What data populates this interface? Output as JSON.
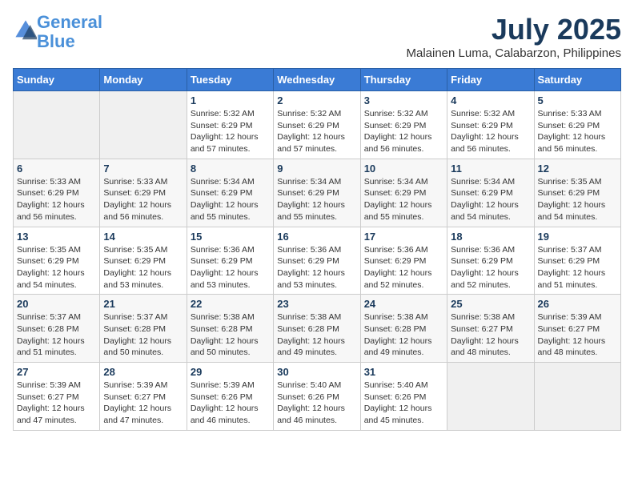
{
  "header": {
    "logo_line1": "General",
    "logo_line2": "Blue",
    "month": "July 2025",
    "location": "Malainen Luma, Calabarzon, Philippines"
  },
  "days_of_week": [
    "Sunday",
    "Monday",
    "Tuesday",
    "Wednesday",
    "Thursday",
    "Friday",
    "Saturday"
  ],
  "weeks": [
    [
      {
        "day": "",
        "info": ""
      },
      {
        "day": "",
        "info": ""
      },
      {
        "day": "1",
        "info": "Sunrise: 5:32 AM\nSunset: 6:29 PM\nDaylight: 12 hours and 57 minutes."
      },
      {
        "day": "2",
        "info": "Sunrise: 5:32 AM\nSunset: 6:29 PM\nDaylight: 12 hours and 57 minutes."
      },
      {
        "day": "3",
        "info": "Sunrise: 5:32 AM\nSunset: 6:29 PM\nDaylight: 12 hours and 56 minutes."
      },
      {
        "day": "4",
        "info": "Sunrise: 5:32 AM\nSunset: 6:29 PM\nDaylight: 12 hours and 56 minutes."
      },
      {
        "day": "5",
        "info": "Sunrise: 5:33 AM\nSunset: 6:29 PM\nDaylight: 12 hours and 56 minutes."
      }
    ],
    [
      {
        "day": "6",
        "info": "Sunrise: 5:33 AM\nSunset: 6:29 PM\nDaylight: 12 hours and 56 minutes."
      },
      {
        "day": "7",
        "info": "Sunrise: 5:33 AM\nSunset: 6:29 PM\nDaylight: 12 hours and 56 minutes."
      },
      {
        "day": "8",
        "info": "Sunrise: 5:34 AM\nSunset: 6:29 PM\nDaylight: 12 hours and 55 minutes."
      },
      {
        "day": "9",
        "info": "Sunrise: 5:34 AM\nSunset: 6:29 PM\nDaylight: 12 hours and 55 minutes."
      },
      {
        "day": "10",
        "info": "Sunrise: 5:34 AM\nSunset: 6:29 PM\nDaylight: 12 hours and 55 minutes."
      },
      {
        "day": "11",
        "info": "Sunrise: 5:34 AM\nSunset: 6:29 PM\nDaylight: 12 hours and 54 minutes."
      },
      {
        "day": "12",
        "info": "Sunrise: 5:35 AM\nSunset: 6:29 PM\nDaylight: 12 hours and 54 minutes."
      }
    ],
    [
      {
        "day": "13",
        "info": "Sunrise: 5:35 AM\nSunset: 6:29 PM\nDaylight: 12 hours and 54 minutes."
      },
      {
        "day": "14",
        "info": "Sunrise: 5:35 AM\nSunset: 6:29 PM\nDaylight: 12 hours and 53 minutes."
      },
      {
        "day": "15",
        "info": "Sunrise: 5:36 AM\nSunset: 6:29 PM\nDaylight: 12 hours and 53 minutes."
      },
      {
        "day": "16",
        "info": "Sunrise: 5:36 AM\nSunset: 6:29 PM\nDaylight: 12 hours and 53 minutes."
      },
      {
        "day": "17",
        "info": "Sunrise: 5:36 AM\nSunset: 6:29 PM\nDaylight: 12 hours and 52 minutes."
      },
      {
        "day": "18",
        "info": "Sunrise: 5:36 AM\nSunset: 6:29 PM\nDaylight: 12 hours and 52 minutes."
      },
      {
        "day": "19",
        "info": "Sunrise: 5:37 AM\nSunset: 6:29 PM\nDaylight: 12 hours and 51 minutes."
      }
    ],
    [
      {
        "day": "20",
        "info": "Sunrise: 5:37 AM\nSunset: 6:28 PM\nDaylight: 12 hours and 51 minutes."
      },
      {
        "day": "21",
        "info": "Sunrise: 5:37 AM\nSunset: 6:28 PM\nDaylight: 12 hours and 50 minutes."
      },
      {
        "day": "22",
        "info": "Sunrise: 5:38 AM\nSunset: 6:28 PM\nDaylight: 12 hours and 50 minutes."
      },
      {
        "day": "23",
        "info": "Sunrise: 5:38 AM\nSunset: 6:28 PM\nDaylight: 12 hours and 49 minutes."
      },
      {
        "day": "24",
        "info": "Sunrise: 5:38 AM\nSunset: 6:28 PM\nDaylight: 12 hours and 49 minutes."
      },
      {
        "day": "25",
        "info": "Sunrise: 5:38 AM\nSunset: 6:27 PM\nDaylight: 12 hours and 48 minutes."
      },
      {
        "day": "26",
        "info": "Sunrise: 5:39 AM\nSunset: 6:27 PM\nDaylight: 12 hours and 48 minutes."
      }
    ],
    [
      {
        "day": "27",
        "info": "Sunrise: 5:39 AM\nSunset: 6:27 PM\nDaylight: 12 hours and 47 minutes."
      },
      {
        "day": "28",
        "info": "Sunrise: 5:39 AM\nSunset: 6:27 PM\nDaylight: 12 hours and 47 minutes."
      },
      {
        "day": "29",
        "info": "Sunrise: 5:39 AM\nSunset: 6:26 PM\nDaylight: 12 hours and 46 minutes."
      },
      {
        "day": "30",
        "info": "Sunrise: 5:40 AM\nSunset: 6:26 PM\nDaylight: 12 hours and 46 minutes."
      },
      {
        "day": "31",
        "info": "Sunrise: 5:40 AM\nSunset: 6:26 PM\nDaylight: 12 hours and 45 minutes."
      },
      {
        "day": "",
        "info": ""
      },
      {
        "day": "",
        "info": ""
      }
    ]
  ]
}
